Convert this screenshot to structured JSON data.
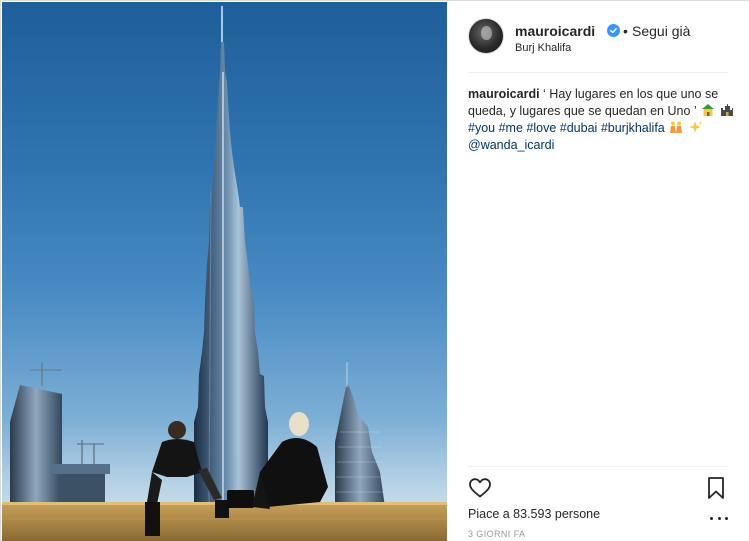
{
  "post": {
    "photo_alt": "Photo by mauroicardi",
    "header": {
      "username": "mauroicardi",
      "separator": "•",
      "follow_label": "Segui già",
      "location": "Burj Khalifa",
      "verified_icon": "verified-badge-icon"
    },
    "caption": {
      "username": "mauroicardi",
      "text": "‘ Hay lugares en los que uno se queda, y lugares que se quedan en Uno ’",
      "emojis": [
        "house-emoji",
        "castle-emoji"
      ],
      "hashtags": [
        "#you",
        "#me",
        "#love",
        "#dubai",
        "#burjkhalifa"
      ],
      "trailing_emojis": [
        "couple-emoji",
        "sparkles-emoji"
      ],
      "mention": "@wanda_icardi"
    },
    "actions": {
      "like_icon": "heart-icon",
      "save_icon": "bookmark-icon",
      "more_icon": "more-options-icon"
    },
    "likes_text": "Piace a 83.593 persone",
    "timestamp": "3 GIORNI FA"
  },
  "colors": {
    "text": "#262626",
    "hashtag": "#003569",
    "verified": "#3897f0",
    "muted": "#999999",
    "divider": "#efefef",
    "sky_top": "#1f5f9a",
    "sky_bottom": "#d9e6ec"
  }
}
